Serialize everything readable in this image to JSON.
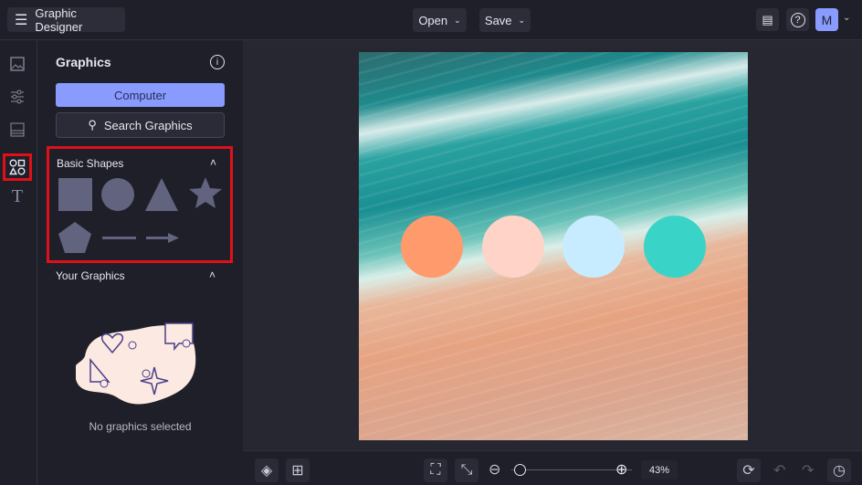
{
  "app": {
    "title": "Graphic Designer"
  },
  "header": {
    "open_label": "Open",
    "save_label": "Save",
    "avatar_initial": "M"
  },
  "panel": {
    "title": "Graphics",
    "computer_label": "Computer",
    "search_label": "Search Graphics",
    "basic_shapes": {
      "title": "Basic Shapes",
      "shapes": [
        "square",
        "circle",
        "triangle",
        "star",
        "pentagon",
        "line",
        "arrow"
      ]
    },
    "your_graphics": {
      "title": "Your Graphics",
      "empty_text": "No graphics selected"
    }
  },
  "canvas": {
    "circle_colors": [
      "#FF9A6C",
      "#FFD3C8",
      "#C8ECFF",
      "#3AD3C8"
    ]
  },
  "footer": {
    "zoom_text": "43%",
    "zoom_fraction": 0.05
  },
  "colors": {
    "accent": "#8a9bff",
    "highlight": "#e0101a"
  }
}
